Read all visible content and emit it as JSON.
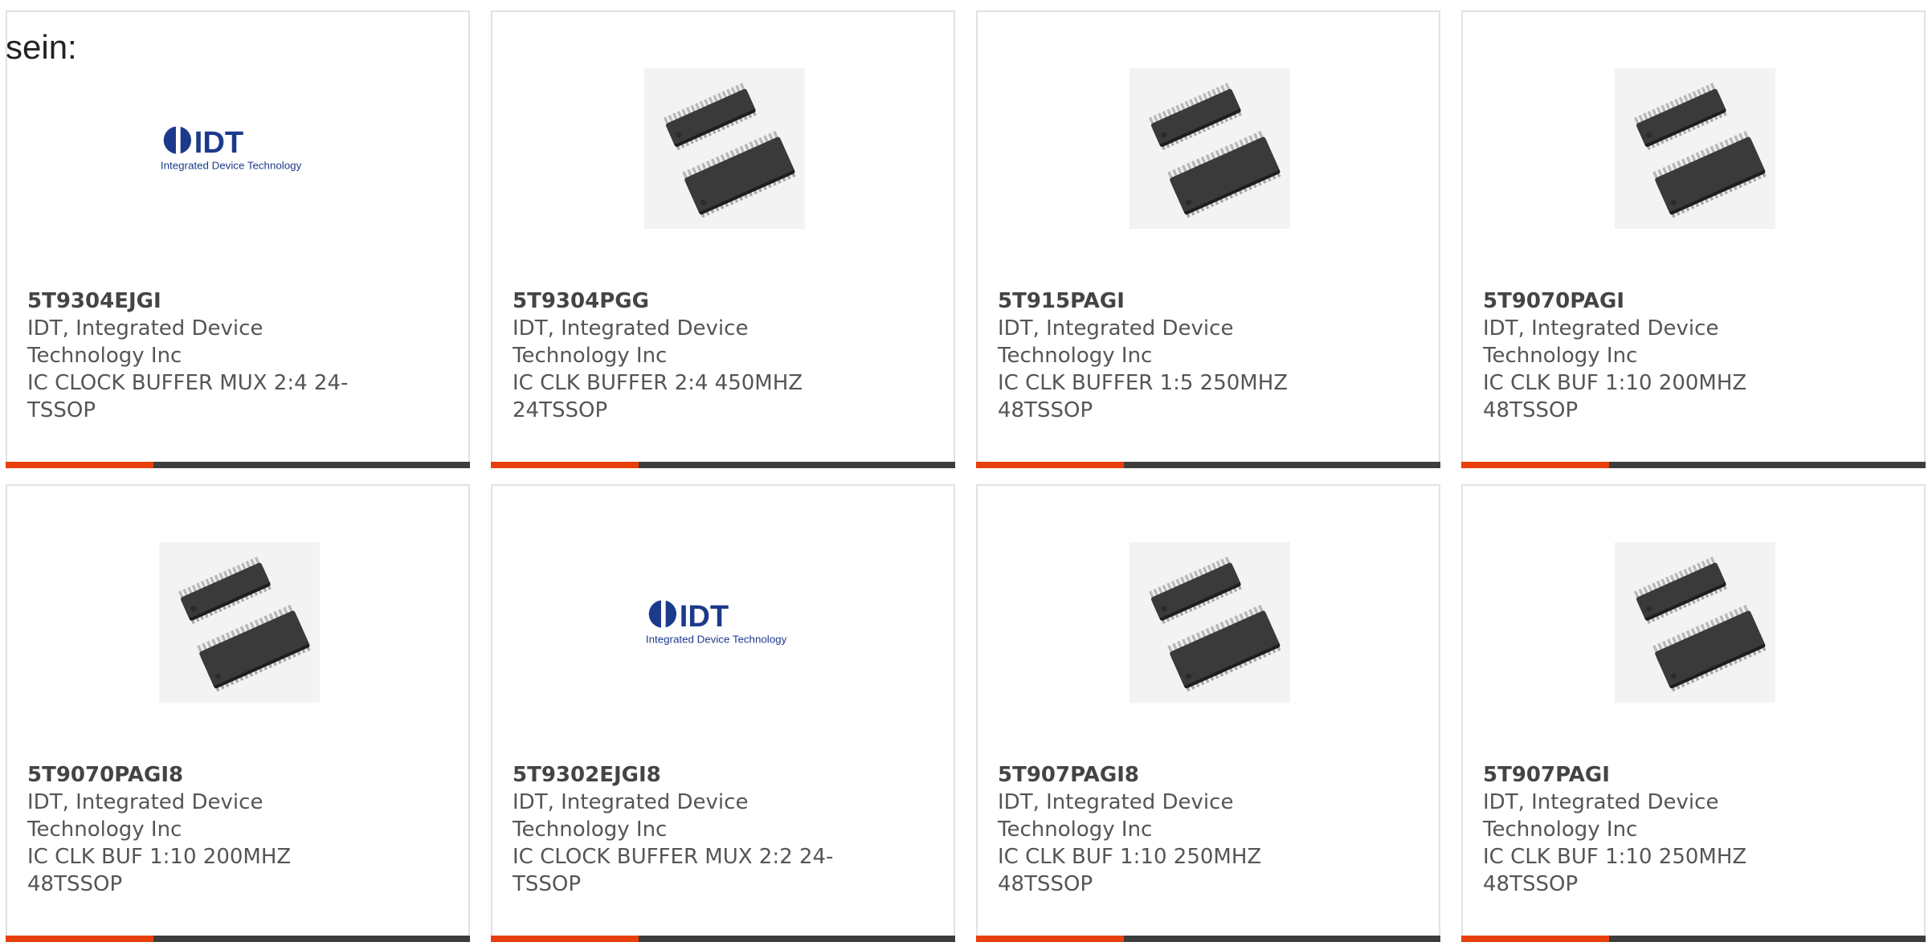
{
  "intro_text": "sein:",
  "accent_color": "#e8400c",
  "bar_color": "#3d3d3d",
  "products": [
    {
      "part_number": "5T9304EJGI",
      "manufacturer_line1": "IDT, Integrated Device",
      "manufacturer_line2": "Technology Inc",
      "description_line1": "IC CLOCK BUFFER MUX 2:4 24-",
      "description_line2": "TSSOP",
      "image": "idt-logo",
      "logo_text": "IDT",
      "logo_subtext": "Integrated Device Technology"
    },
    {
      "part_number": "5T9304PGG",
      "manufacturer_line1": "IDT, Integrated Device",
      "manufacturer_line2": "Technology Inc",
      "description_line1": "IC CLK BUFFER 2:4 450MHZ",
      "description_line2": "24TSSOP",
      "image": "tssop-chip"
    },
    {
      "part_number": "5T915PAGI",
      "manufacturer_line1": "IDT, Integrated Device",
      "manufacturer_line2": "Technology Inc",
      "description_line1": "IC CLK BUFFER 1:5 250MHZ",
      "description_line2": "48TSSOP",
      "image": "tssop-chip"
    },
    {
      "part_number": "5T9070PAGI",
      "manufacturer_line1": "IDT, Integrated Device",
      "manufacturer_line2": "Technology Inc",
      "description_line1": "IC CLK BUF 1:10 200MHZ",
      "description_line2": "48TSSOP",
      "image": "tssop-chip"
    },
    {
      "part_number": "5T9070PAGI8",
      "manufacturer_line1": "IDT, Integrated Device",
      "manufacturer_line2": "Technology Inc",
      "description_line1": "IC CLK BUF 1:10 200MHZ",
      "description_line2": "48TSSOP",
      "image": "tssop-chip"
    },
    {
      "part_number": "5T9302EJGI8",
      "manufacturer_line1": "IDT, Integrated Device",
      "manufacturer_line2": "Technology Inc",
      "description_line1": "IC CLOCK BUFFER MUX 2:2 24-",
      "description_line2": "TSSOP",
      "image": "idt-logo",
      "logo_text": "IDT",
      "logo_subtext": "Integrated Device Technology"
    },
    {
      "part_number": "5T907PAGI8",
      "manufacturer_line1": "IDT, Integrated Device",
      "manufacturer_line2": "Technology Inc",
      "description_line1": "IC CLK BUF 1:10 250MHZ",
      "description_line2": "48TSSOP",
      "image": "tssop-chip"
    },
    {
      "part_number": "5T907PAGI",
      "manufacturer_line1": "IDT, Integrated Device",
      "manufacturer_line2": "Technology Inc",
      "description_line1": "IC CLK BUF 1:10 250MHZ",
      "description_line2": "48TSSOP",
      "image": "tssop-chip"
    }
  ]
}
